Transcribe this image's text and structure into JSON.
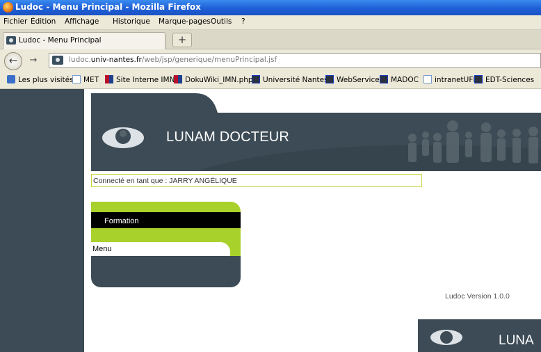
{
  "window": {
    "title": "Ludoc - Menu Principal - Mozilla Firefox"
  },
  "menu": [
    "Fichier",
    "Édition",
    "Affichage",
    "Historique",
    "Marque-pages",
    "Outils",
    "?"
  ],
  "tab": {
    "label": "Ludoc - Menu Principal",
    "new_tab": "+"
  },
  "nav": {
    "url_prefix": "ludoc.",
    "url_domain": "univ-nantes.fr",
    "url_path": "/web/jsp/generique/menuPrincipal.jsf"
  },
  "bookmarks": [
    {
      "label": "Les plus visités",
      "icon": "most-visited-icon"
    },
    {
      "label": "MET",
      "icon": "page-icon"
    },
    {
      "label": "Site Interne IMN",
      "icon": "imn-icon"
    },
    {
      "label": "DokuWiki_IMN.php",
      "icon": "imn-icon"
    },
    {
      "label": "Université Nantes",
      "icon": "univ-icon"
    },
    {
      "label": "WebService",
      "icon": "univ-icon"
    },
    {
      "label": "MADOC",
      "icon": "univ-icon"
    },
    {
      "label": "intranetUFR",
      "icon": "page-icon"
    },
    {
      "label": "EDT-Sciences",
      "icon": "univ-icon"
    }
  ],
  "page": {
    "banner_title": "LUNAM DOCTEUR",
    "connected": "Connecté en tant que : JARRY  ANGÉLIQUE",
    "menu_header": "Formation",
    "menu_item": "Menu",
    "version": "Ludoc Version 1.0.0",
    "banner2_text": "LUNA"
  },
  "colors": {
    "sidebar": "#3c4b55",
    "accent_green": "#a9d12b",
    "titlebar": "#1f5fd6"
  }
}
